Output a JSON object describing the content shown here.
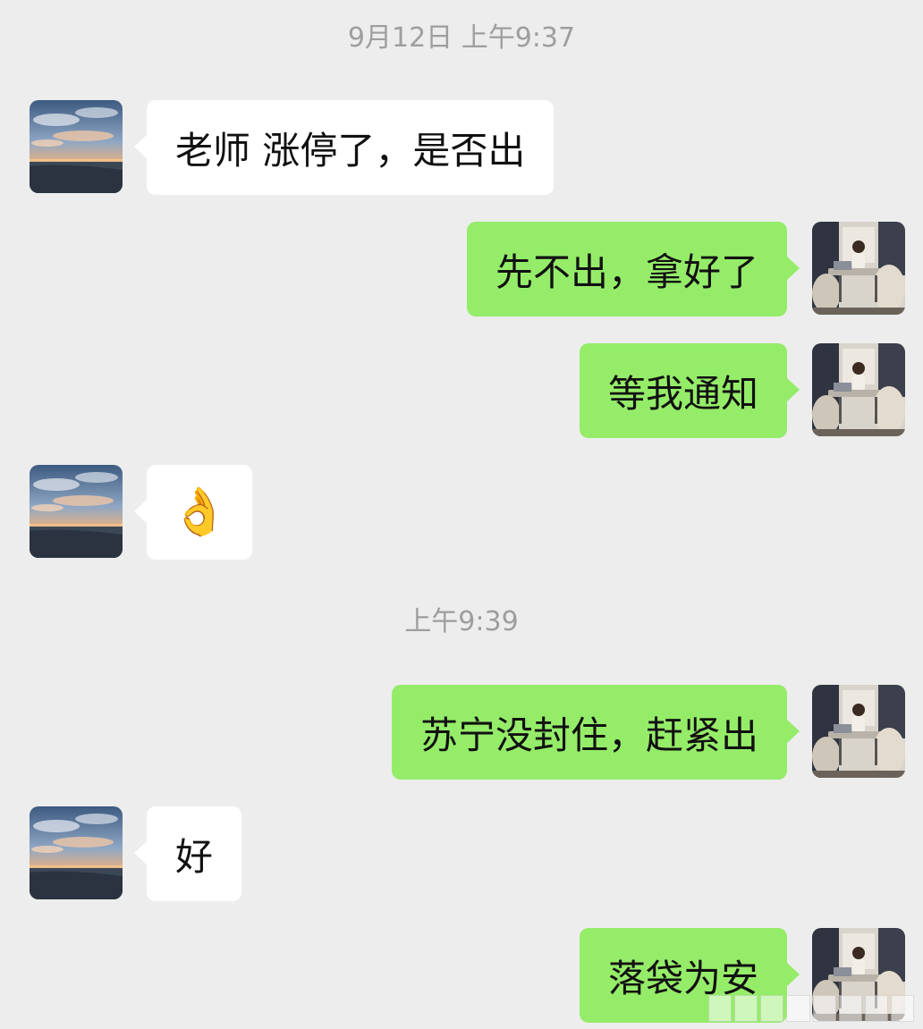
{
  "chat": {
    "timestamps": {
      "first": "9月12日 上午9:37",
      "second": "上午9:39"
    },
    "messages": [
      {
        "side": "left",
        "text": "老师 涨停了，是否出"
      },
      {
        "side": "right",
        "text": "先不出，拿好了"
      },
      {
        "side": "right",
        "text": "等我通知"
      },
      {
        "side": "left",
        "text": "👌",
        "kind": "emoji",
        "emoji_name": "ok-hand-emoji"
      },
      {
        "side": "right",
        "text": "苏宁没封住，赶紧出"
      },
      {
        "side": "left",
        "text": "好"
      },
      {
        "side": "right",
        "text": "落袋为安"
      }
    ]
  },
  "colors": {
    "background": "#ededed",
    "sent_bubble": "#95ec69",
    "received_bubble": "#ffffff",
    "timestamp_text": "#9e9e9e"
  },
  "avatars": {
    "contact": "sunset-beach-avatar",
    "self": "office-woman-avatar"
  }
}
